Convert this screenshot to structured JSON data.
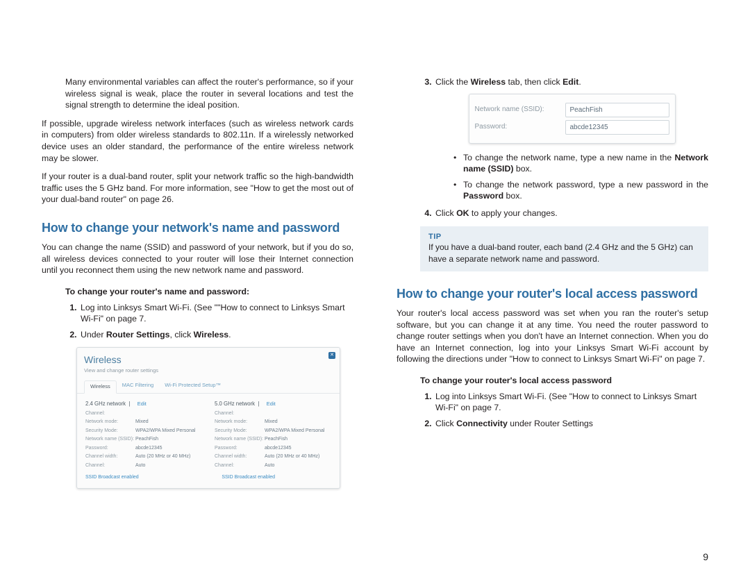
{
  "pageNumber": "9",
  "left": {
    "p_env": "Many environmental variables can affect the router's performance, so if your wireless signal is weak, place the router in several locations and test the signal strength to determine the ideal position.",
    "p_upgrade": "If possible, upgrade wireless network interfaces (such as wireless network cards in computers) from older wireless standards to 802.11n. If a wirelessly networked device uses an older standard, the performance of the entire wireless network may be slower.",
    "p_dualband": "If your router is a dual-band router, split your network traffic so the high-bandwidth traffic uses the 5 GHz band. For more information, see \"How to get the most out of your dual-band router\" on page 26.",
    "h_change": "How to change your network's name and password",
    "p_changeIntro": "You can change the name (SSID) and password of your network, but if you do so, all wireless devices connected to your router will lose their Internet connection until you reconnect them using the new network name and password.",
    "procTitle": "To change your router's name and password:",
    "s1a": "Log into Linksys Smart Wi-Fi. (See \"\"How to connect to Linksys Smart Wi-Fi\" on page 7.",
    "s2_pre": "Under ",
    "s2_b1": "Router Settings",
    "s2_mid": ", click ",
    "s2_b2": "Wireless",
    "s2_post": "."
  },
  "wshot": {
    "title": "Wireless",
    "subtitle": "View and change router settings",
    "tabs": [
      "Wireless",
      "MAC Filtering",
      "Wi-Fi Protected Setup™"
    ],
    "net24": "2.4 GHz network",
    "net50": "5.0 GHz network",
    "edit": "Edit",
    "rows": [
      {
        "k": "Channel:",
        "v": ""
      },
      {
        "k": "Network mode:",
        "v": "Mixed"
      },
      {
        "k": "Security Mode:",
        "v": "WPA2/WPA Mixed Personal"
      },
      {
        "k": "Network name (SSID):",
        "v": "PeachFish"
      },
      {
        "k": "Password:",
        "v": "abcde12345"
      },
      {
        "k": "Channel width:",
        "v": "Auto (20 MHz or 40 MHz)"
      },
      {
        "k": "Channel:",
        "v": "Auto"
      }
    ],
    "bcast": "SSID Broadcast enabled"
  },
  "right": {
    "s3_pre": "Click the ",
    "s3_b1": "Wireless",
    "s3_mid": " tab, then click ",
    "s3_b2": "Edit",
    "s3_post": ".",
    "panel_ssid_label": "Network name (SSID):",
    "panel_ssid_value": "PeachFish",
    "panel_pw_label": "Password:",
    "panel_pw_value": "abcde12345",
    "bul1_pre": "To change the network name, type a new name in the ",
    "bul1_b": "Network name (SSID)",
    "bul1_post": " box.",
    "bul2_pre": "To change the network password, type a new password in the ",
    "bul2_b": "Password",
    "bul2_post": " box.",
    "s4_pre": "Click ",
    "s4_b": "OK",
    "s4_post": " to apply your changes.",
    "tipLabel": "TIP",
    "tipBody": "If you have a dual-band router, each band (2.4 GHz and the 5 GHz) can have a separate network name and password.",
    "h_local": "How to change your router's local access password",
    "p_localIntro": "Your router's local access password was set when you ran the router's setup software, but you can change it at any time. You need the router password to change router settings when you don't have an Internet connection. When you do have an Internet connection, log into your Linksys Smart Wi-Fi account by following the directions under \"How to connect to Linksys Smart Wi-Fi\" on page 7.",
    "procTitle2": "To change your router's local access password",
    "ls1": "Log into Linksys Smart Wi-Fi. (See \"How to connect to Linksys Smart Wi-Fi\" on page 7.",
    "ls2_pre": "Click ",
    "ls2_b": "Connectivity",
    "ls2_post": " under Router Settings"
  }
}
